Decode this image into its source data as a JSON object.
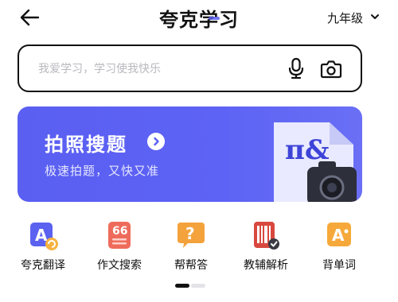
{
  "header": {
    "title": "夸克学习",
    "grade": "九年级",
    "back_icon": "arrow-left-icon",
    "grade_icon": "chevron-down-icon"
  },
  "search": {
    "placeholder": "我爱学习，学习使我快乐",
    "value": "",
    "mic_icon": "microphone-icon",
    "camera_icon": "camera-icon"
  },
  "banner": {
    "title": "拍照搜题",
    "subtitle": "极速拍题，又快又准",
    "arrow_icon": "chevron-right-circle-icon",
    "illustration_text": "π&",
    "color": "#5a5ff2"
  },
  "shortcuts": [
    {
      "label": "夸克翻译",
      "icon": "translate-icon",
      "color": "#5b62f0"
    },
    {
      "label": "作文搜索",
      "icon": "essay-icon",
      "color": "#ee6b5b"
    },
    {
      "label": "帮帮答",
      "icon": "question-icon",
      "color": "#f4a23c"
    },
    {
      "label": "教辅解析",
      "icon": "textbook-icon",
      "color": "#d8483f"
    },
    {
      "label": "背单词",
      "icon": "vocabulary-icon",
      "color": "#f6a93a"
    }
  ],
  "pager": {
    "pages": 2,
    "current": 1
  }
}
